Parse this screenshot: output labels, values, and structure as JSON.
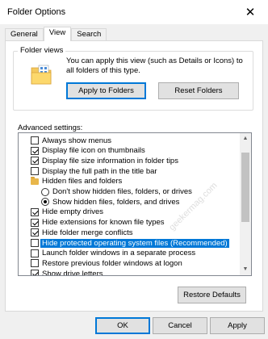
{
  "window": {
    "title": "Folder Options",
    "close_glyph": "✕"
  },
  "tabs": [
    {
      "label": "General",
      "active": false
    },
    {
      "label": "View",
      "active": true
    },
    {
      "label": "Search",
      "active": false
    }
  ],
  "folder_views": {
    "label": "Folder views",
    "description": "You can apply this view (such as Details or Icons) to all folders of this type.",
    "apply_button": "Apply to Folders",
    "reset_button": "Reset Folders"
  },
  "advanced": {
    "label": "Advanced settings:",
    "items": [
      {
        "type": "checkbox",
        "label": "Always show menus",
        "checked": false,
        "indent": 1,
        "selected": false
      },
      {
        "type": "checkbox",
        "label": "Display file icon on thumbnails",
        "checked": true,
        "indent": 1,
        "selected": false
      },
      {
        "type": "checkbox",
        "label": "Display file size information in folder tips",
        "checked": true,
        "indent": 1,
        "selected": false
      },
      {
        "type": "checkbox",
        "label": "Display the full path in the title bar",
        "checked": false,
        "indent": 1,
        "selected": false
      },
      {
        "type": "folder",
        "label": "Hidden files and folders",
        "indent": 1,
        "selected": false
      },
      {
        "type": "radio",
        "label": "Don't show hidden files, folders, or drives",
        "checked": false,
        "indent": 2,
        "selected": false
      },
      {
        "type": "radio",
        "label": "Show hidden files, folders, and drives",
        "checked": true,
        "indent": 2,
        "selected": false
      },
      {
        "type": "checkbox",
        "label": "Hide empty drives",
        "checked": true,
        "indent": 1,
        "selected": false
      },
      {
        "type": "checkbox",
        "label": "Hide extensions for known file types",
        "checked": true,
        "indent": 1,
        "selected": false
      },
      {
        "type": "checkbox",
        "label": "Hide folder merge conflicts",
        "checked": true,
        "indent": 1,
        "selected": false
      },
      {
        "type": "checkbox",
        "label": "Hide protected operating system files (Recommended)",
        "checked": false,
        "indent": 1,
        "selected": true
      },
      {
        "type": "checkbox",
        "label": "Launch folder windows in a separate process",
        "checked": false,
        "indent": 1,
        "selected": false
      },
      {
        "type": "checkbox",
        "label": "Restore previous folder windows at logon",
        "checked": false,
        "indent": 1,
        "selected": false
      },
      {
        "type": "checkbox",
        "label": "Show drive letters",
        "checked": true,
        "indent": 1,
        "selected": false
      }
    ]
  },
  "restore_defaults": "Restore Defaults",
  "footer": {
    "ok": "OK",
    "cancel": "Cancel",
    "apply": "Apply"
  },
  "watermark": "geekermag.com",
  "colors": {
    "selection": "#0078d7",
    "dialog_bg": "#f0f0f0",
    "button_bg": "#e1e1e1"
  }
}
